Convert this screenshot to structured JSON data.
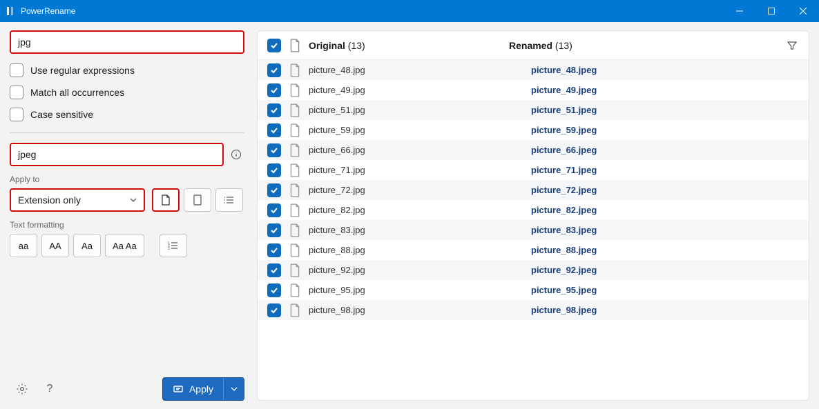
{
  "window": {
    "title": "PowerRename"
  },
  "search": {
    "value": "jpg",
    "useRegex": "Use regular expressions",
    "matchAll": "Match all occurrences",
    "caseSensitive": "Case sensitive"
  },
  "replace": {
    "value": "jpeg"
  },
  "applyTo": {
    "label": "Apply to",
    "selected": "Extension only"
  },
  "formatting": {
    "label": "Text formatting",
    "lower": "aa",
    "upper": "AA",
    "title": "Aa",
    "capEach": "Aa Aa"
  },
  "header": {
    "original": "Original",
    "renamed": "Renamed",
    "countOriginal": "(13)",
    "countRenamed": "(13)"
  },
  "files": [
    {
      "original": "picture_48.jpg",
      "renamed": "picture_48.jpeg"
    },
    {
      "original": "picture_49.jpg",
      "renamed": "picture_49.jpeg"
    },
    {
      "original": "picture_51.jpg",
      "renamed": "picture_51.jpeg"
    },
    {
      "original": "picture_59.jpg",
      "renamed": "picture_59.jpeg"
    },
    {
      "original": "picture_66.jpg",
      "renamed": "picture_66.jpeg"
    },
    {
      "original": "picture_71.jpg",
      "renamed": "picture_71.jpeg"
    },
    {
      "original": "picture_72.jpg",
      "renamed": "picture_72.jpeg"
    },
    {
      "original": "picture_82.jpg",
      "renamed": "picture_82.jpeg"
    },
    {
      "original": "picture_83.jpg",
      "renamed": "picture_83.jpeg"
    },
    {
      "original": "picture_88.jpg",
      "renamed": "picture_88.jpeg"
    },
    {
      "original": "picture_92.jpg",
      "renamed": "picture_92.jpeg"
    },
    {
      "original": "picture_95.jpg",
      "renamed": "picture_95.jpeg"
    },
    {
      "original": "picture_98.jpg",
      "renamed": "picture_98.jpeg"
    }
  ],
  "footer": {
    "apply": "Apply"
  }
}
